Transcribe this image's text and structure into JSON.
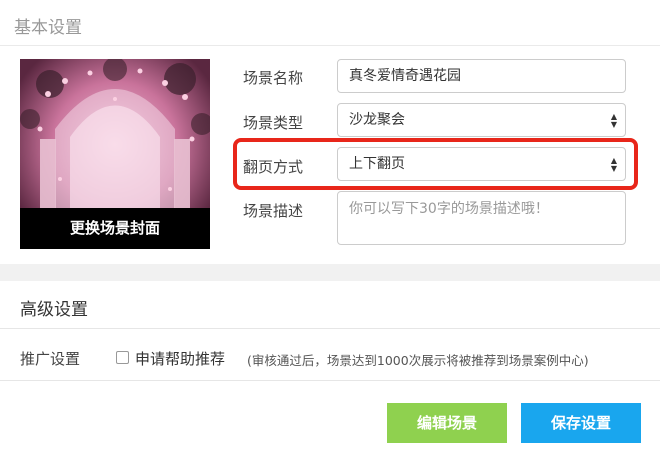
{
  "basic": {
    "title": "基本设置",
    "cover_button": "更换场景封面",
    "name_label": "场景名称",
    "name_value": "真冬爱情奇遇花园",
    "type_label": "场景类型",
    "type_value": "沙龙聚会",
    "flip_label": "翻页方式",
    "flip_value": "上下翻页",
    "desc_label": "场景描述",
    "desc_placeholder": "你可以写下30字的场景描述哦！"
  },
  "advanced": {
    "title": "高级设置",
    "promo_label": "推广设置",
    "promo_checkbox_label": "申请帮助推荐",
    "promo_checked": false,
    "promo_note": "(审核通过后，场景达到1000次展示将被推荐到场景案例中心)"
  },
  "buttons": {
    "edit": "编辑场景",
    "save": "保存设置"
  },
  "colors": {
    "highlight": "#e8261a",
    "edit_button": "#8fd14f",
    "save_button": "#19a6ee"
  },
  "icons": {
    "select_arrow": "updown-arrows-icon"
  }
}
